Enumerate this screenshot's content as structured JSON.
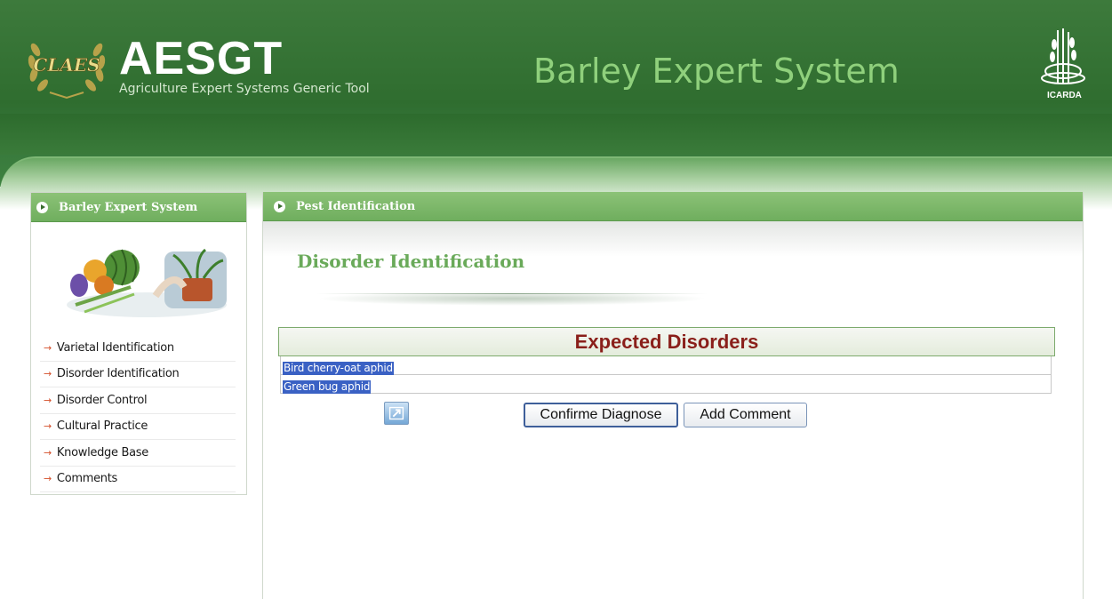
{
  "header": {
    "claes_logo_text": "CLAES",
    "app_name": "AESGT",
    "app_subtitle": "Agriculture Expert Systems Generic Tool",
    "system_title": "Barley Expert System",
    "partner_logo_text": "ICARDA"
  },
  "sidebar": {
    "title": "Barley Expert System",
    "items": [
      {
        "label": "Varietal Identification"
      },
      {
        "label": "Disorder Identification"
      },
      {
        "label": "Disorder Control"
      },
      {
        "label": "Cultural Practice"
      },
      {
        "label": "Knowledge Base"
      },
      {
        "label": "Comments"
      }
    ]
  },
  "main": {
    "panel_title": "Pest Identification",
    "section_title": "Disorder Identification",
    "results_header": "Expected Disorders",
    "results": [
      {
        "text": "Bird cherry-oat aphid"
      },
      {
        "text": "Green bug aphid"
      }
    ],
    "confirm_label": "Confirme Diagnose",
    "comment_label": "Add Comment"
  },
  "colors": {
    "header_green": "#2f6d2f",
    "panel_green": "#7bb86a",
    "title_green": "#6aaa5a",
    "heading_red": "#8a1f1a",
    "selection_blue": "#3a61c4"
  }
}
